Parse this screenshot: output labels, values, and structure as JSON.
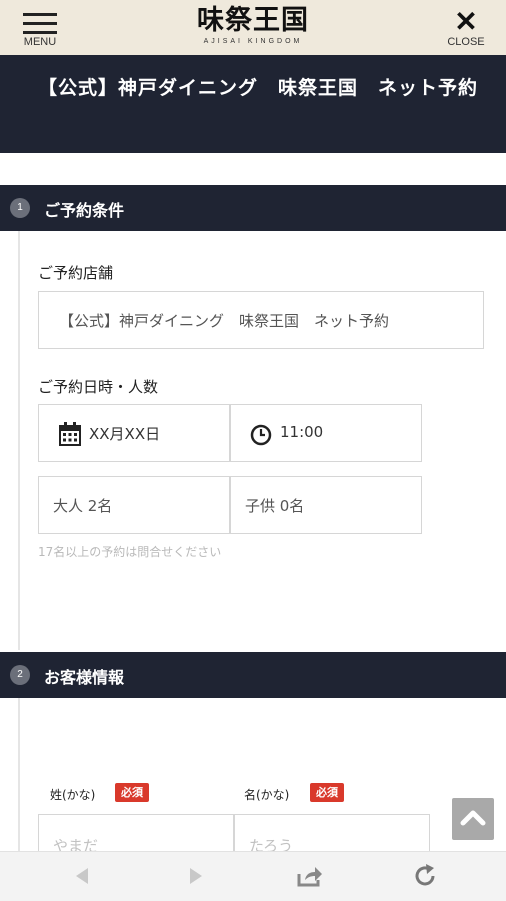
{
  "header": {
    "menu_label": "MENU",
    "logo_main": "味祭王国",
    "logo_sub": "AJISAI KINGDOM",
    "close_label": "CLOSE"
  },
  "page": {
    "title": "【公式】神戸ダイニング　味祭王国　ネット予約"
  },
  "section1": {
    "number": "1",
    "title": "ご予約条件",
    "store_label": "ご予約店舗",
    "store_value": "【公式】神戸ダイニング　味祭王国　ネット予約",
    "datetime_label": "ご予約日時・人数",
    "date_value": "XX月XX日",
    "time_value": "11:00",
    "adults_value": "大人 2名",
    "children_value": "子供 0名",
    "note": "17名以上の予約は問合せください"
  },
  "section2": {
    "number": "2",
    "title": "お客様情報",
    "lastname_kana_label": "姓(かな)",
    "firstname_kana_label": "名(かな)",
    "required_badge": "必須",
    "lastname_kana_placeholder": "やまだ",
    "firstname_kana_placeholder": "たろう"
  },
  "colors": {
    "dark_navy": "#1f2433",
    "header_beige": "#efe9dc",
    "required_red": "#d9392b"
  },
  "icons": {
    "menu": "hamburger-icon",
    "close": "close-icon",
    "calendar": "calendar-icon",
    "clock": "clock-icon",
    "scroll_top": "chevron-up-icon",
    "back": "back-arrow-icon",
    "forward": "forward-arrow-icon",
    "share": "share-icon",
    "reload": "reload-icon"
  }
}
